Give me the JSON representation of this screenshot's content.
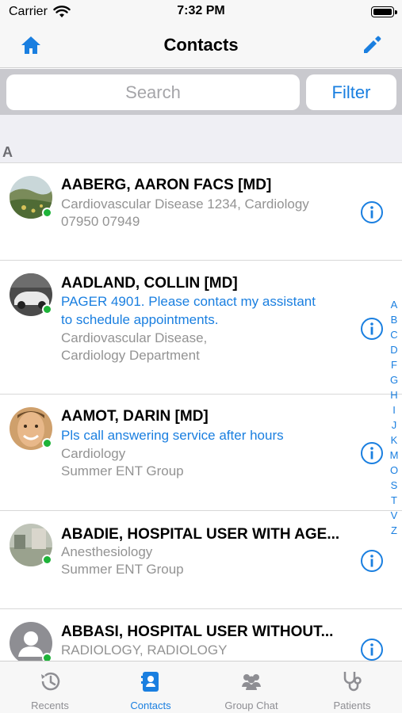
{
  "status": {
    "carrier": "Carrier",
    "time": "7:32 PM"
  },
  "nav": {
    "title": "Contacts"
  },
  "search": {
    "placeholder": "Search",
    "filter_label": "Filter"
  },
  "section": {
    "letter": "A"
  },
  "contacts": [
    {
      "name": "AABERG, AARON FACS [MD]",
      "lines": [
        {
          "text": "Cardiovascular Disease 1234, Cardiology",
          "style": "gray"
        },
        {
          "text": "07950 07949",
          "style": "gray"
        }
      ],
      "online": true,
      "avatar": "landscape-photo"
    },
    {
      "name": "AADLAND, COLLIN [MD]",
      "lines": [
        {
          "text": "PAGER 4901. Please contact my assistant",
          "style": "blue"
        },
        {
          "text": "to schedule appointments.",
          "style": "blue"
        },
        {
          "text": "Cardiovascular Disease,",
          "style": "gray"
        },
        {
          "text": "Cardiology Department",
          "style": "gray"
        }
      ],
      "online": true,
      "avatar": "car-photo"
    },
    {
      "name": "AAMOT, DARIN [MD]",
      "lines": [
        {
          "text": "Pls call answering service after hours",
          "style": "blue"
        },
        {
          "text": "Cardiology",
          "style": "gray"
        },
        {
          "text": " Summer ENT Group",
          "style": "gray"
        }
      ],
      "online": true,
      "avatar": "face-photo"
    },
    {
      "name": "ABADIE, HOSPITAL USER WITH AGE...",
      "lines": [
        {
          "text": "Anesthesiology",
          "style": "gray"
        },
        {
          "text": " Summer ENT Group",
          "style": "gray"
        }
      ],
      "online": true,
      "avatar": "room-photo"
    },
    {
      "name": "ABBASI, HOSPITAL USER WITHOUT...",
      "lines": [
        {
          "text": "RADIOLOGY, RADIOLOGY",
          "style": "gray"
        }
      ],
      "online": true,
      "avatar": "placeholder-person"
    }
  ],
  "index_letters": [
    "A",
    "B",
    "C",
    "D",
    "F",
    "G",
    "H",
    "I",
    "J",
    "K",
    "M",
    "O",
    "S",
    "T",
    "V",
    "Z"
  ],
  "tabs": [
    {
      "label": "Recents",
      "icon": "clock-history-icon",
      "active": false
    },
    {
      "label": "Contacts",
      "icon": "contact-card-icon",
      "active": true
    },
    {
      "label": "Group Chat",
      "icon": "group-icon",
      "active": false
    },
    {
      "label": "Patients",
      "icon": "stethoscope-icon",
      "active": false
    }
  ],
  "colors": {
    "accent": "#1a7fe0",
    "online": "#1eb339",
    "secondary_text": "#939393",
    "tab_inactive": "#8e8e93"
  }
}
